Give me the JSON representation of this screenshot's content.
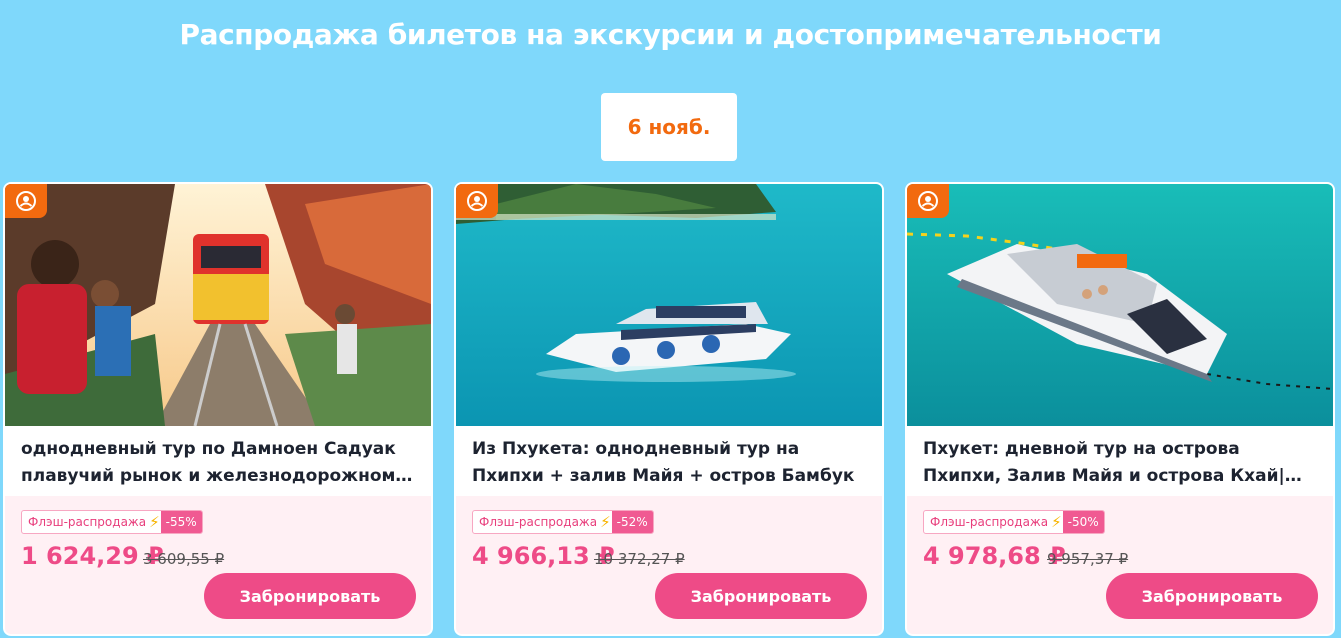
{
  "page": {
    "headline": "Распродажа билетов на экскурсии и достопримечательности",
    "date_chip": "6 нояб."
  },
  "cards": [
    {
      "title": "однодневный тур по Дамноен Садуак плавучий рынок и железнодорожному рынку Меклонг",
      "flash_label": "Флэш-распродажа",
      "discount": "-55%",
      "price": "1 624,29 ₽",
      "old_price": "3 609,55 ₽",
      "book_label": "Забронировать",
      "category_icon": "tour-guide-icon"
    },
    {
      "title": "Из Пхукета: однодневный тур на Пхипхи + залив Майя + остров Бамбук",
      "flash_label": "Флэш-распродажа",
      "discount": "-52%",
      "price": "4 966,13 ₽",
      "old_price": "10 372,27 ₽",
      "book_label": "Забронировать",
      "category_icon": "tour-guide-icon"
    },
    {
      "title": "Пхукет: дневной тур на острова Пхипхи, Залив Майя и острова Кхай|Бесплатный WiFi",
      "flash_label": "Флэш-распродажа",
      "discount": "-50%",
      "price": "4 978,68 ₽",
      "old_price": "9 957,37 ₽",
      "book_label": "Забронировать",
      "category_icon": "tour-guide-icon"
    }
  ],
  "colors": {
    "background": "#7fd8fb",
    "accent_orange": "#f26a0f",
    "price_pink": "#ee4b87",
    "price_zone": "#fff0f4"
  }
}
